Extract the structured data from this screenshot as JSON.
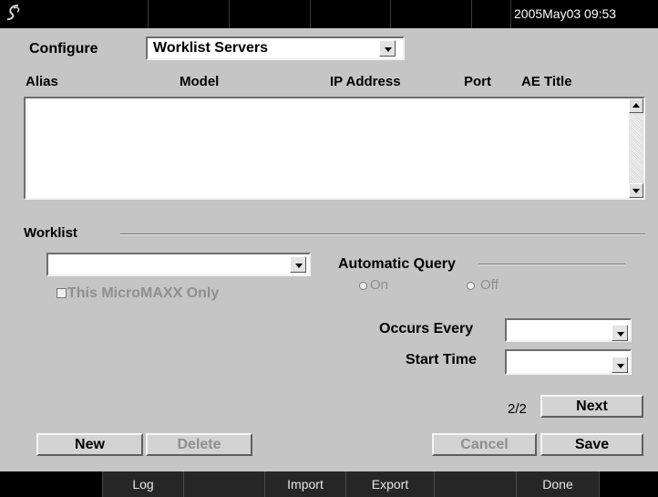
{
  "topbar": {
    "datetime": "2005May03   09:53"
  },
  "configure": {
    "label": "Configure",
    "selected": "Worklist Servers"
  },
  "table": {
    "columns": [
      "Alias",
      "Model",
      "IP Address",
      "Port",
      "AE Title"
    ],
    "rows": []
  },
  "worklist": {
    "section_label": "Worklist",
    "server_selected": "",
    "this_device_only_label": "This MicroMAXX Only",
    "automatic_query_label": "Automatic Query",
    "on_label": "On",
    "off_label": "Off",
    "occurs_every_label": "Occurs Every",
    "occurs_every_value": "",
    "start_time_label": "Start Time",
    "start_time_value": ""
  },
  "pager": {
    "page": "2/2",
    "next_label": "Next"
  },
  "buttons": {
    "new": "New",
    "delete": "Delete",
    "cancel": "Cancel",
    "save": "Save"
  },
  "softkeys": [
    "Log",
    "",
    "Import",
    "Export",
    "",
    "Done"
  ]
}
